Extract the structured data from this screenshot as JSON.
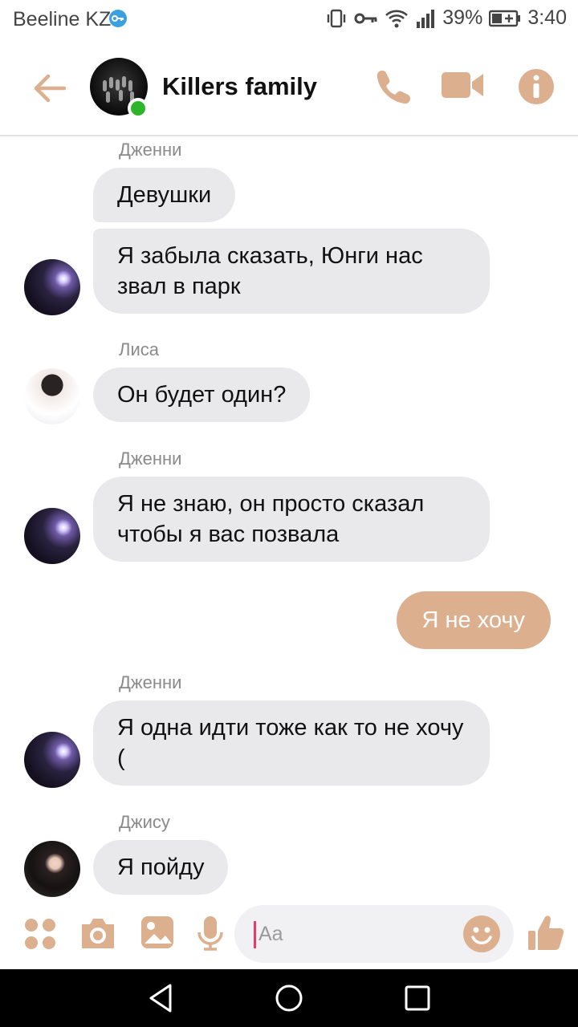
{
  "status_bar": {
    "carrier": "Beeline KZ",
    "battery": "39%",
    "time": "3:40",
    "icons": [
      "vpn-key-icon",
      "vibrate-icon",
      "key-icon",
      "wifi-icon",
      "signal-icon",
      "battery-icon"
    ]
  },
  "header": {
    "title": "Killers family",
    "online": true,
    "icons": [
      "back-arrow-icon",
      "phone-icon",
      "video-icon",
      "info-icon"
    ]
  },
  "messages": [
    {
      "sender": "Дженни",
      "texts": [
        "Девушки",
        "Я забыла сказать, Юнги нас звал в парк"
      ]
    },
    {
      "sender": "Лиса",
      "texts": [
        "Он будет один?"
      ]
    },
    {
      "sender": "Дженни",
      "texts": [
        "Я не знаю, он просто сказал чтобы я вас позвала"
      ]
    },
    {
      "sender": "me",
      "texts": [
        "Я не хочу"
      ]
    },
    {
      "sender": "Дженни",
      "texts": [
        "Я одна идти тоже как то не хочу ("
      ]
    },
    {
      "sender": "Джису",
      "texts": [
        "Я пойду"
      ]
    }
  ],
  "composer": {
    "placeholder": "Aa",
    "icons": [
      "apps-icon",
      "camera-icon",
      "gallery-icon",
      "microphone-icon",
      "emoji-icon",
      "thumbs-up-icon"
    ]
  },
  "colors": {
    "accent": "#dcaf8e",
    "received_bubble": "#e9e9ec",
    "online": "#2fb52c"
  }
}
